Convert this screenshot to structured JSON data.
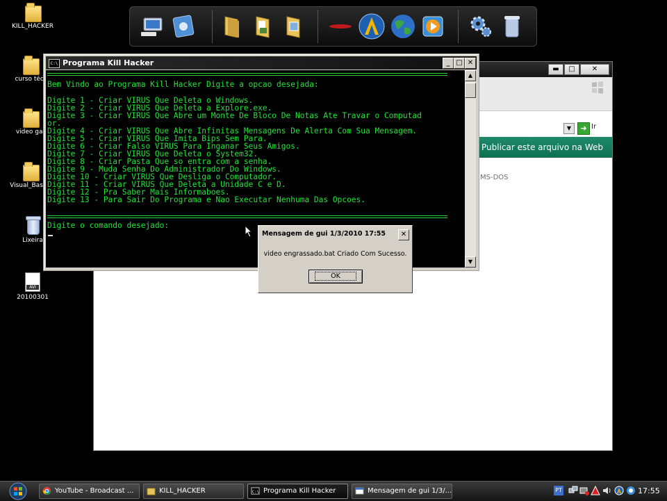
{
  "desktop": {
    "icons": [
      {
        "label": "KILL_HACKER",
        "type": "folder"
      },
      {
        "label": "curso técr",
        "type": "folder"
      },
      {
        "label": "video gar",
        "type": "folder"
      },
      {
        "label": "Visual_Basic_",
        "type": "folder"
      },
      {
        "label": "Lixeira",
        "type": "trash"
      },
      {
        "label": "20100301",
        "type": "avi",
        "badge": "AVI"
      }
    ]
  },
  "dock": {
    "items": [
      "computer-icon",
      "control-panel-icon",
      "folder-icon",
      "documents-icon",
      "pictures-icon",
      "red-bar-icon",
      "avast-icon",
      "globe-icon",
      "media-player-icon",
      "settings-gears-icon",
      "recycle-bin-icon"
    ]
  },
  "explorer_window": {
    "go_label": "Ir",
    "task_link": "Publicar este arquivo na Web",
    "type_text": "MS-DOS",
    "buttons": {
      "minimize": "▬",
      "maximize": "□",
      "close": "✕"
    }
  },
  "console": {
    "title": "Programa Kill Hacker",
    "icon_text": "C:\\",
    "buttons": {
      "minimize": "_",
      "maximize": "□",
      "close": "✕"
    },
    "welcome": "Bem Vindo ao Programa Kill Hacker Digite a opcao desejada:",
    "options": [
      "Digite 1 - Criar VIRUS Que Deleta o Windows.",
      "Digite 2 - Criar VIRUS Que Deleta a Explore.exe.",
      "Digite 3 - Criar VIRUS Que Abre um Monte De Bloco De Notas Ate Travar o Computad",
      "or.",
      "Digite 4 - Criar VIRUS Que Abre Infinitas Mensagens De Alerta Com Sua Mensagem.",
      "Digite 5 - Criar VIRUS Que Imita Bips Sem Para.",
      "Digite 6 - Criar Falso VIRUS Para Inganar Seus Amigos.",
      "Digite 7 - Criar VIRUS Que Deleta o System32.",
      "Digite 8 - Criar Pasta Que so entra com a senha.",
      "Digite 9 - Muda Senha Do Administrador Do Windows.",
      "Digite 10 - Criar VIRUS Que Desliga o Computador.",
      "Digite 11 - Criar VIRUS Que Deleta a Unidade C e D.",
      "Digite 12 - Pra Saber Mais Informaboes.",
      "Digite 13 - Para Sair Do Programa e Nao Executar Nenhuma Das Opcoes."
    ],
    "prompt": "Digite o comando desejado:",
    "text_color": "#22e33a"
  },
  "message_box": {
    "title": "Mensagem de gui 1/3/2010 17:55",
    "close": "✕",
    "message": "video engrassado.bat Criado Com Sucesso.",
    "ok_label": "OK"
  },
  "taskbar": {
    "tasks": [
      {
        "label": "YouTube - Broadcast ...",
        "icon": "chrome-icon"
      },
      {
        "label": "KILL_HACKER",
        "icon": "folder-icon"
      },
      {
        "label": "Programa Kill Hacker",
        "icon": "cmd-icon",
        "active": true
      },
      {
        "label": "Mensagem de gui 1/3/...",
        "icon": "window-icon"
      }
    ],
    "language": "PT",
    "clock": "17:55"
  }
}
